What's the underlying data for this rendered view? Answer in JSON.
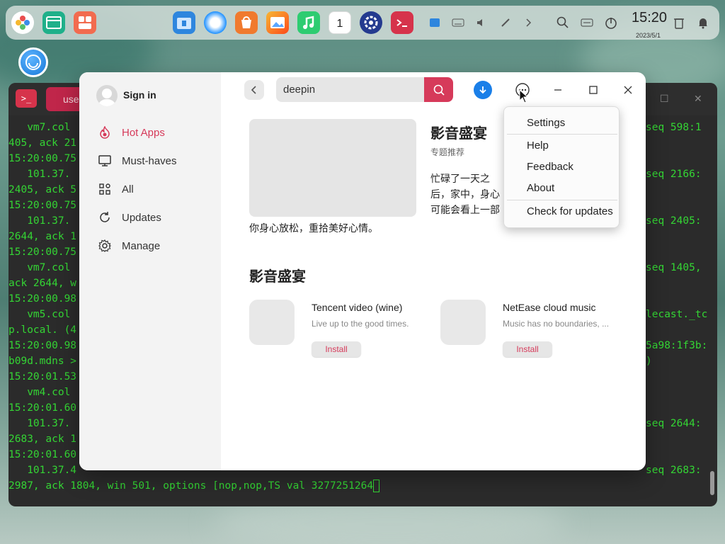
{
  "dock": {
    "clock_time": "15:20",
    "clock_date": "2023/5/1",
    "calendar_day": "1"
  },
  "terminal": {
    "tab_label": "use",
    "icon_text": ">_",
    "lines_left": [
      "   vm7.col",
      "405, ack 21",
      "15:20:00.75",
      "   101.37.",
      "2405, ack 5",
      "15:20:00.75",
      "   101.37.",
      "2644, ack 1",
      "15:20:00.75",
      "   vm7.col",
      "ack 2644, w",
      "15:20:00.98",
      "   vm5.col",
      "p.local. (4",
      "15:20:00.98",
      "b09d.mdns >",
      "15:20:01.53",
      "   vm4.col",
      "15:20:01.60",
      "   101.37.",
      "2683, ack 1",
      "15:20:01.60",
      "   101.37.4",
      "2987, ack 1804, win 501, options [nop,nop,TS val 3277251264"
    ],
    "lines_right": [
      "seq 598:1",
      "",
      "",
      "seq 2166:",
      "",
      "",
      "seq 2405:",
      "",
      "",
      "seq 1405,",
      "",
      "",
      "lecast._tc",
      "",
      "5a98:1f3b:",
      ")",
      "",
      "",
      "",
      "seq 2644:",
      "",
      "",
      "seq 2683:",
      ""
    ]
  },
  "sidebar": {
    "sign_in": "Sign in",
    "items": [
      {
        "label": "Hot Apps",
        "icon": "flame-icon"
      },
      {
        "label": "Must-haves",
        "icon": "monitor-icon"
      },
      {
        "label": "All",
        "icon": "grid-icon"
      },
      {
        "label": "Updates",
        "icon": "refresh-icon"
      },
      {
        "label": "Manage",
        "icon": "gear-icon"
      }
    ]
  },
  "search": {
    "value": "deepin"
  },
  "banner": {
    "title": "影音盛宴",
    "tag": "专题推荐",
    "desc": "忙碌了一天之后，家中，身心可能会看上一部电影、听",
    "desc_tail": "你身心放松，重拾美好心情。"
  },
  "section": {
    "title": "影音盛宴",
    "apps": [
      {
        "name": "Tencent video (wine)",
        "desc": "Live up to the good times.",
        "install": "Install"
      },
      {
        "name": "NetEase cloud music",
        "desc": "Music has no boundaries, ...",
        "install": "Install"
      }
    ]
  },
  "menu": {
    "items": [
      "Settings",
      "Help",
      "Feedback",
      "About",
      "Check for updates"
    ]
  },
  "colors": {
    "accent": "#d63a5a",
    "download": "#1a7fe8",
    "terminal_text": "#34d534"
  }
}
